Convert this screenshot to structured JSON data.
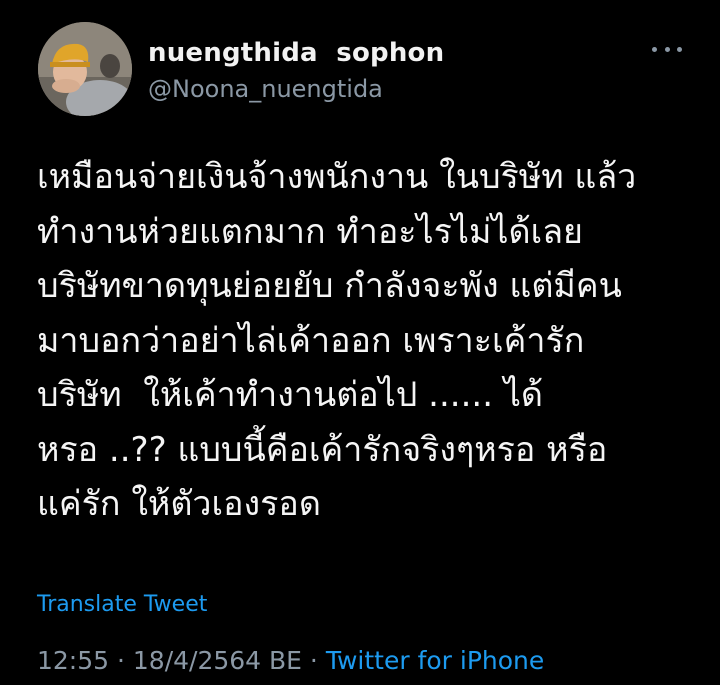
{
  "author": {
    "display_name": "nuengthida  sophon",
    "handle": "@Noona_nuengtida",
    "avatar_icon": "profile-photo"
  },
  "more_icon": "more-horizontal-icon",
  "tweet": {
    "lines": [
      "เหมือนจ่ายเงินจ้างพนักงาน ในบริษัท แล้ว",
      "ทำงานห่วยแตกมาก ทำอะไรไม่ได้เลย",
      "บริษัทขาดทุนย่อยยับ กำลังจะพัง แต่มีคน",
      "มาบอกว่าอย่าไล่เค้าออก เพราะเค้ารัก",
      "บริษัท  ให้เค้าทำงานต่อไป ...... ได้",
      "หรอ ..?? แบบนี้คือเค้ารักจริงๆหรอ หรือ",
      "แค่รัก ให้ตัวเองรอด"
    ]
  },
  "translate_label": "Translate Tweet",
  "meta": {
    "time": "12:55",
    "separator": " · ",
    "date": "18/4/2564 BE",
    "source": "Twitter for iPhone"
  },
  "colors": {
    "background": "#000000",
    "text": "#f5f5f5",
    "secondary": "#8b98a5",
    "link": "#1d9bf0"
  }
}
